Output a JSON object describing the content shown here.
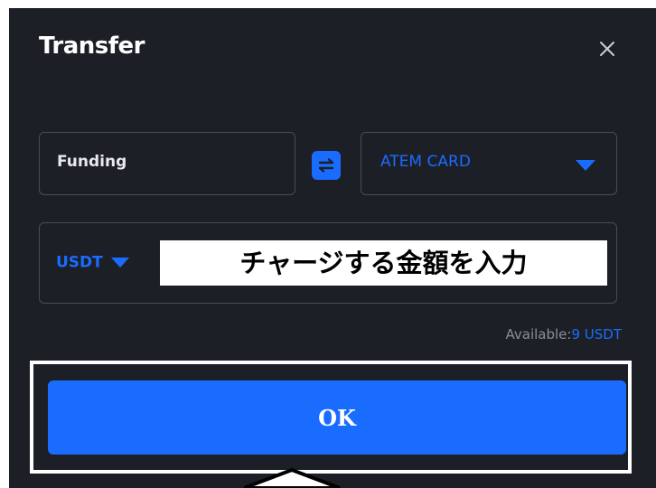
{
  "modal": {
    "title": "Transfer"
  },
  "transfer": {
    "from_account": "Funding",
    "to_account": "ATEM CARD",
    "currency": "USDT",
    "amount_placeholder": "チャージする金額を入力",
    "available_label": "Available:",
    "available_value": "9 USDT"
  },
  "actions": {
    "ok_label": "OK"
  },
  "icons": {
    "close": "close-icon",
    "swap": "swap-arrows-icon",
    "dropdown": "caret-down-icon",
    "annotation": "pointer-arrow-icon"
  },
  "colors": {
    "modal_background": "#1c1f26",
    "accent": "#1a6cff",
    "field_border": "#484c56",
    "highlight": "#ffffff"
  }
}
